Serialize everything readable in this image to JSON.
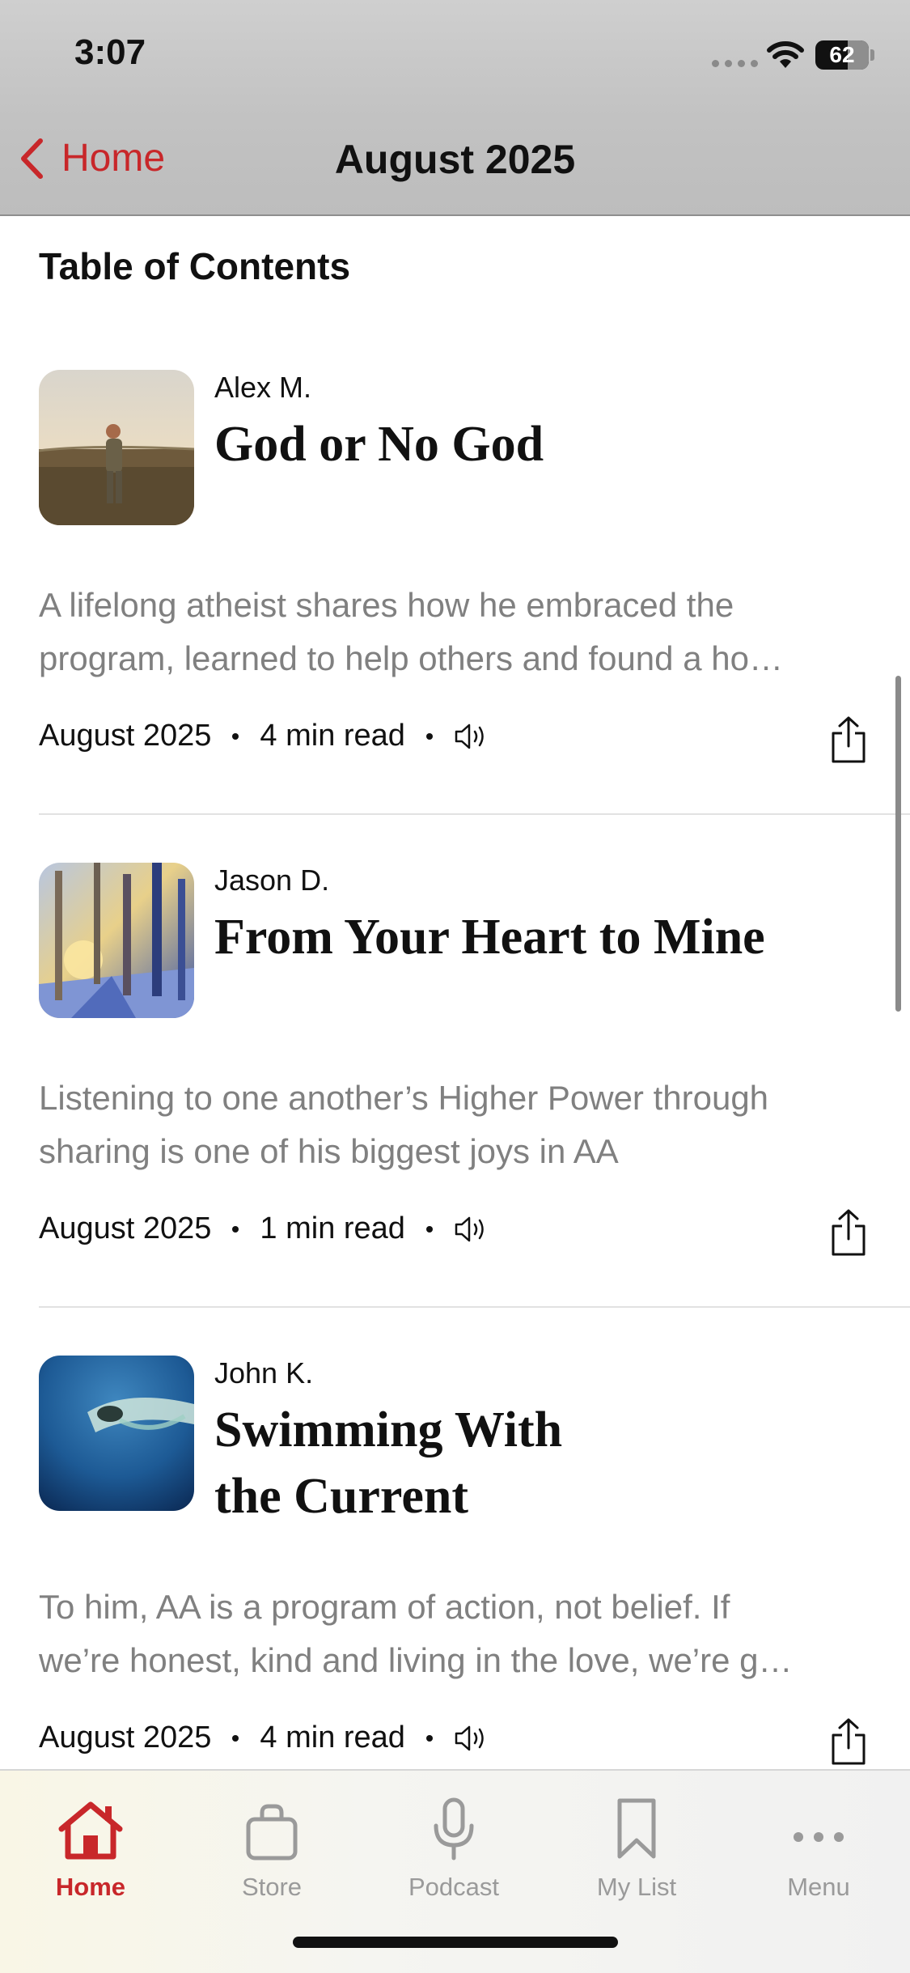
{
  "status_bar": {
    "time": "3:07",
    "battery": "62"
  },
  "nav": {
    "back_label": "Home",
    "title": "August 2025"
  },
  "section_title": "Table of Contents",
  "articles": [
    {
      "author": "Alex M.",
      "title_lines": [
        "God or No God"
      ],
      "summary_lines": [
        "A lifelong atheist shares how he embraced the",
        "program, learned to help others and found a ho…"
      ],
      "date": "August 2025",
      "read_time": "4 min read"
    },
    {
      "author": "Jason D.",
      "title_lines": [
        "From Your Heart to Mine"
      ],
      "summary_lines": [
        "Listening to one another’s Higher Power through",
        "sharing is one of his biggest joys in AA"
      ],
      "date": "August 2025",
      "read_time": "1 min read"
    },
    {
      "author": "John K.",
      "title_lines": [
        "Swimming With",
        "the Current"
      ],
      "summary_lines": [
        "To him, AA is a program of action, not belief. If",
        "we’re honest, kind and living in the love, we’re g…"
      ],
      "date": "August 2025",
      "read_time": "4 min read"
    }
  ],
  "tabs": [
    {
      "label": "Home",
      "icon": "house-icon",
      "active": true
    },
    {
      "label": "Store",
      "icon": "shopping-bag-icon",
      "active": false
    },
    {
      "label": "Podcast",
      "icon": "microphone-icon",
      "active": false
    },
    {
      "label": "My List",
      "icon": "bookmark-icon",
      "active": false
    },
    {
      "label": "Menu",
      "icon": "more-dots-icon",
      "active": false
    }
  ],
  "colors": {
    "accent": "#c8272a",
    "inactive": "#9a9a9a",
    "summary_text": "#808080"
  }
}
